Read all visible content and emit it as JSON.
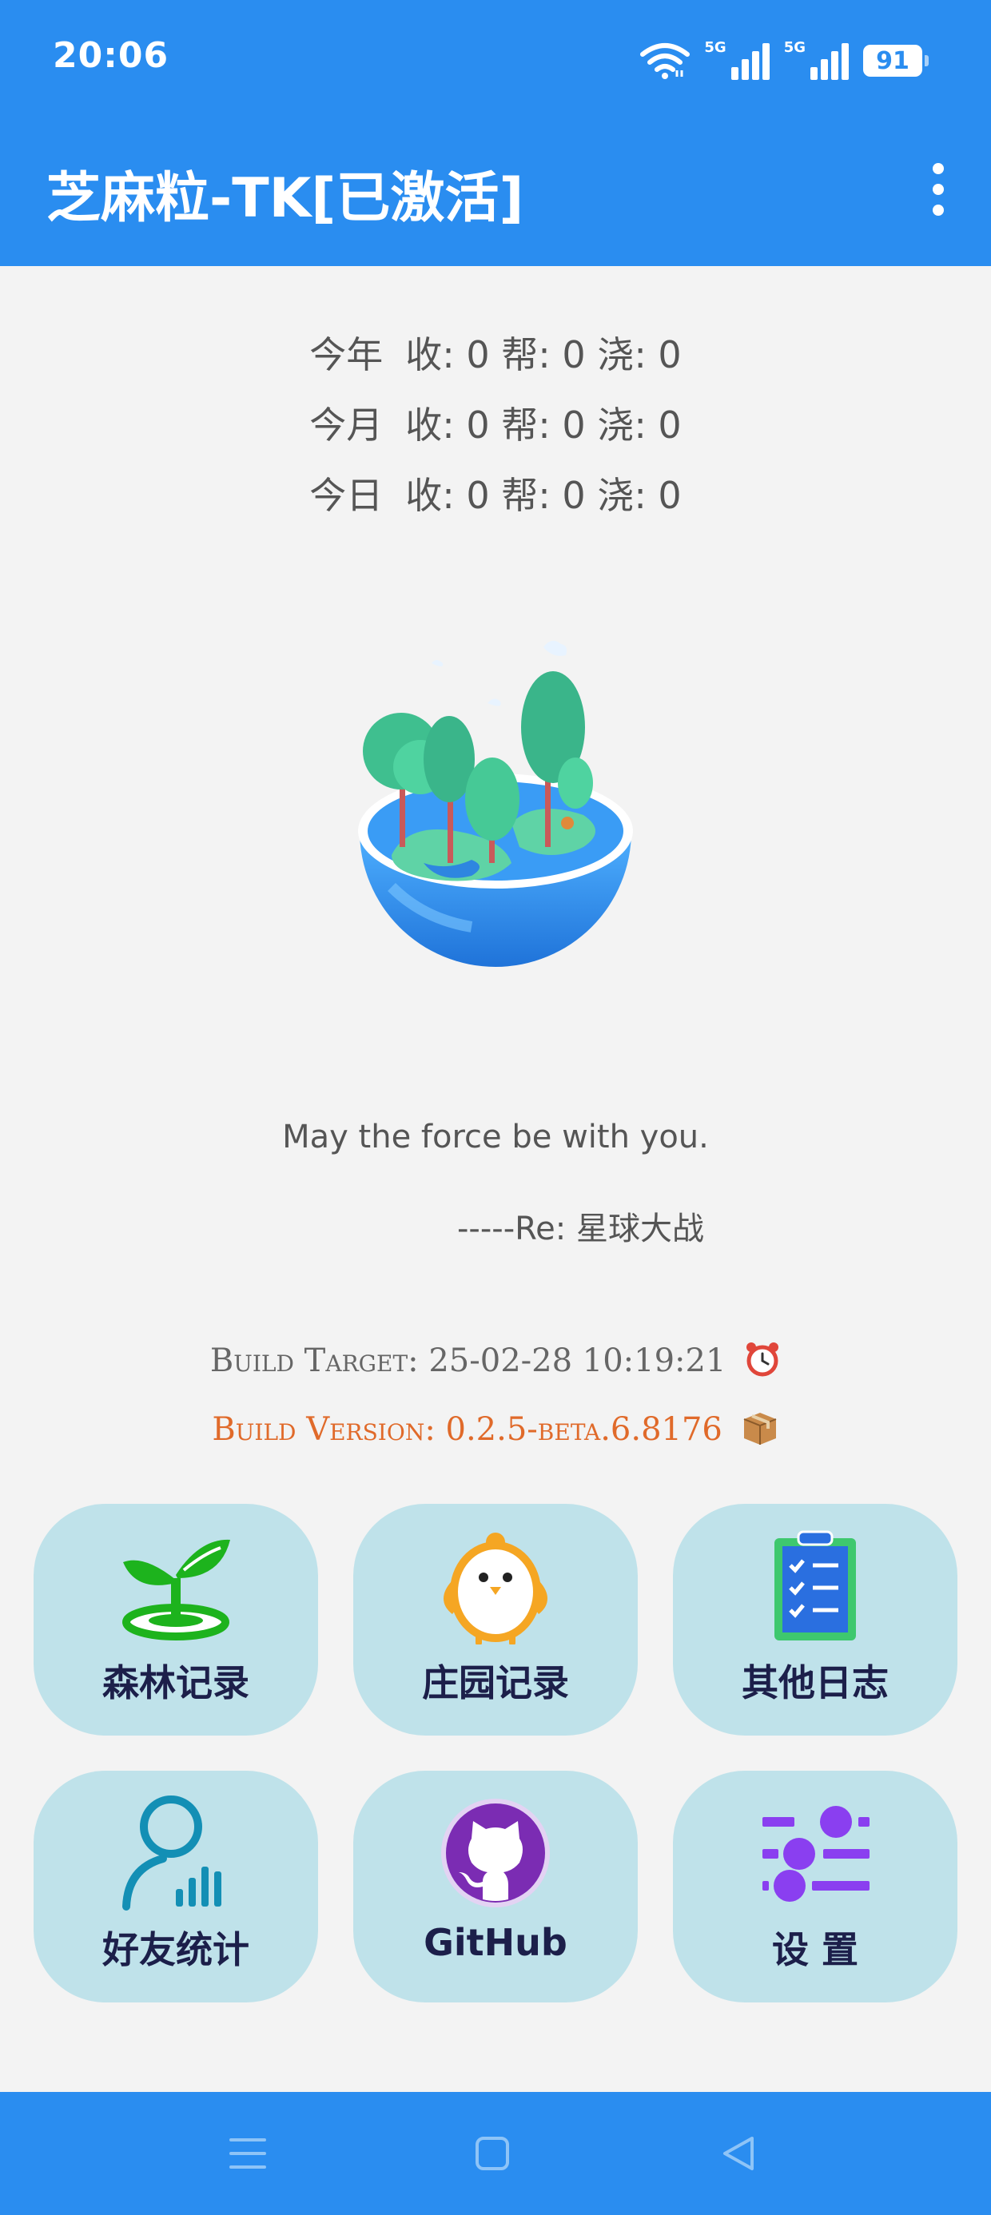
{
  "status_bar": {
    "time": "20:06",
    "network1": "5G",
    "network2": "5G",
    "battery": "91"
  },
  "app_bar": {
    "title": "芝麻粒-TK[已激活]"
  },
  "stats": [
    {
      "period": "今年",
      "text": "收: 0 帮: 0 浇: 0"
    },
    {
      "period": "今月",
      "text": "收: 0 帮: 0 浇: 0"
    },
    {
      "period": "今日",
      "text": "收: 0 帮: 0 浇: 0"
    }
  ],
  "quote": {
    "text": "May the force be with you.",
    "author": "-----Re: 星球大战"
  },
  "build": {
    "target": "Build Target: 25-02-28 10:19:21",
    "version": "Build Version: 0.2.5-beta.6.8176"
  },
  "menu": [
    {
      "label": "森林记录",
      "icon": "sprout-icon"
    },
    {
      "label": "庄园记录",
      "icon": "chick-icon"
    },
    {
      "label": "其他日志",
      "icon": "clipboard-icon"
    },
    {
      "label": "好友统计",
      "icon": "friend-stats-icon"
    },
    {
      "label": "GitHub",
      "icon": "github-icon"
    },
    {
      "label": "设 置",
      "icon": "settings-sliders-icon"
    }
  ],
  "colors": {
    "primary": "#2a8df0",
    "background": "#f3f3f3",
    "tile": "#bfe2ea",
    "tile_text": "#1c1f4a",
    "build_version": "#e06a2a"
  }
}
